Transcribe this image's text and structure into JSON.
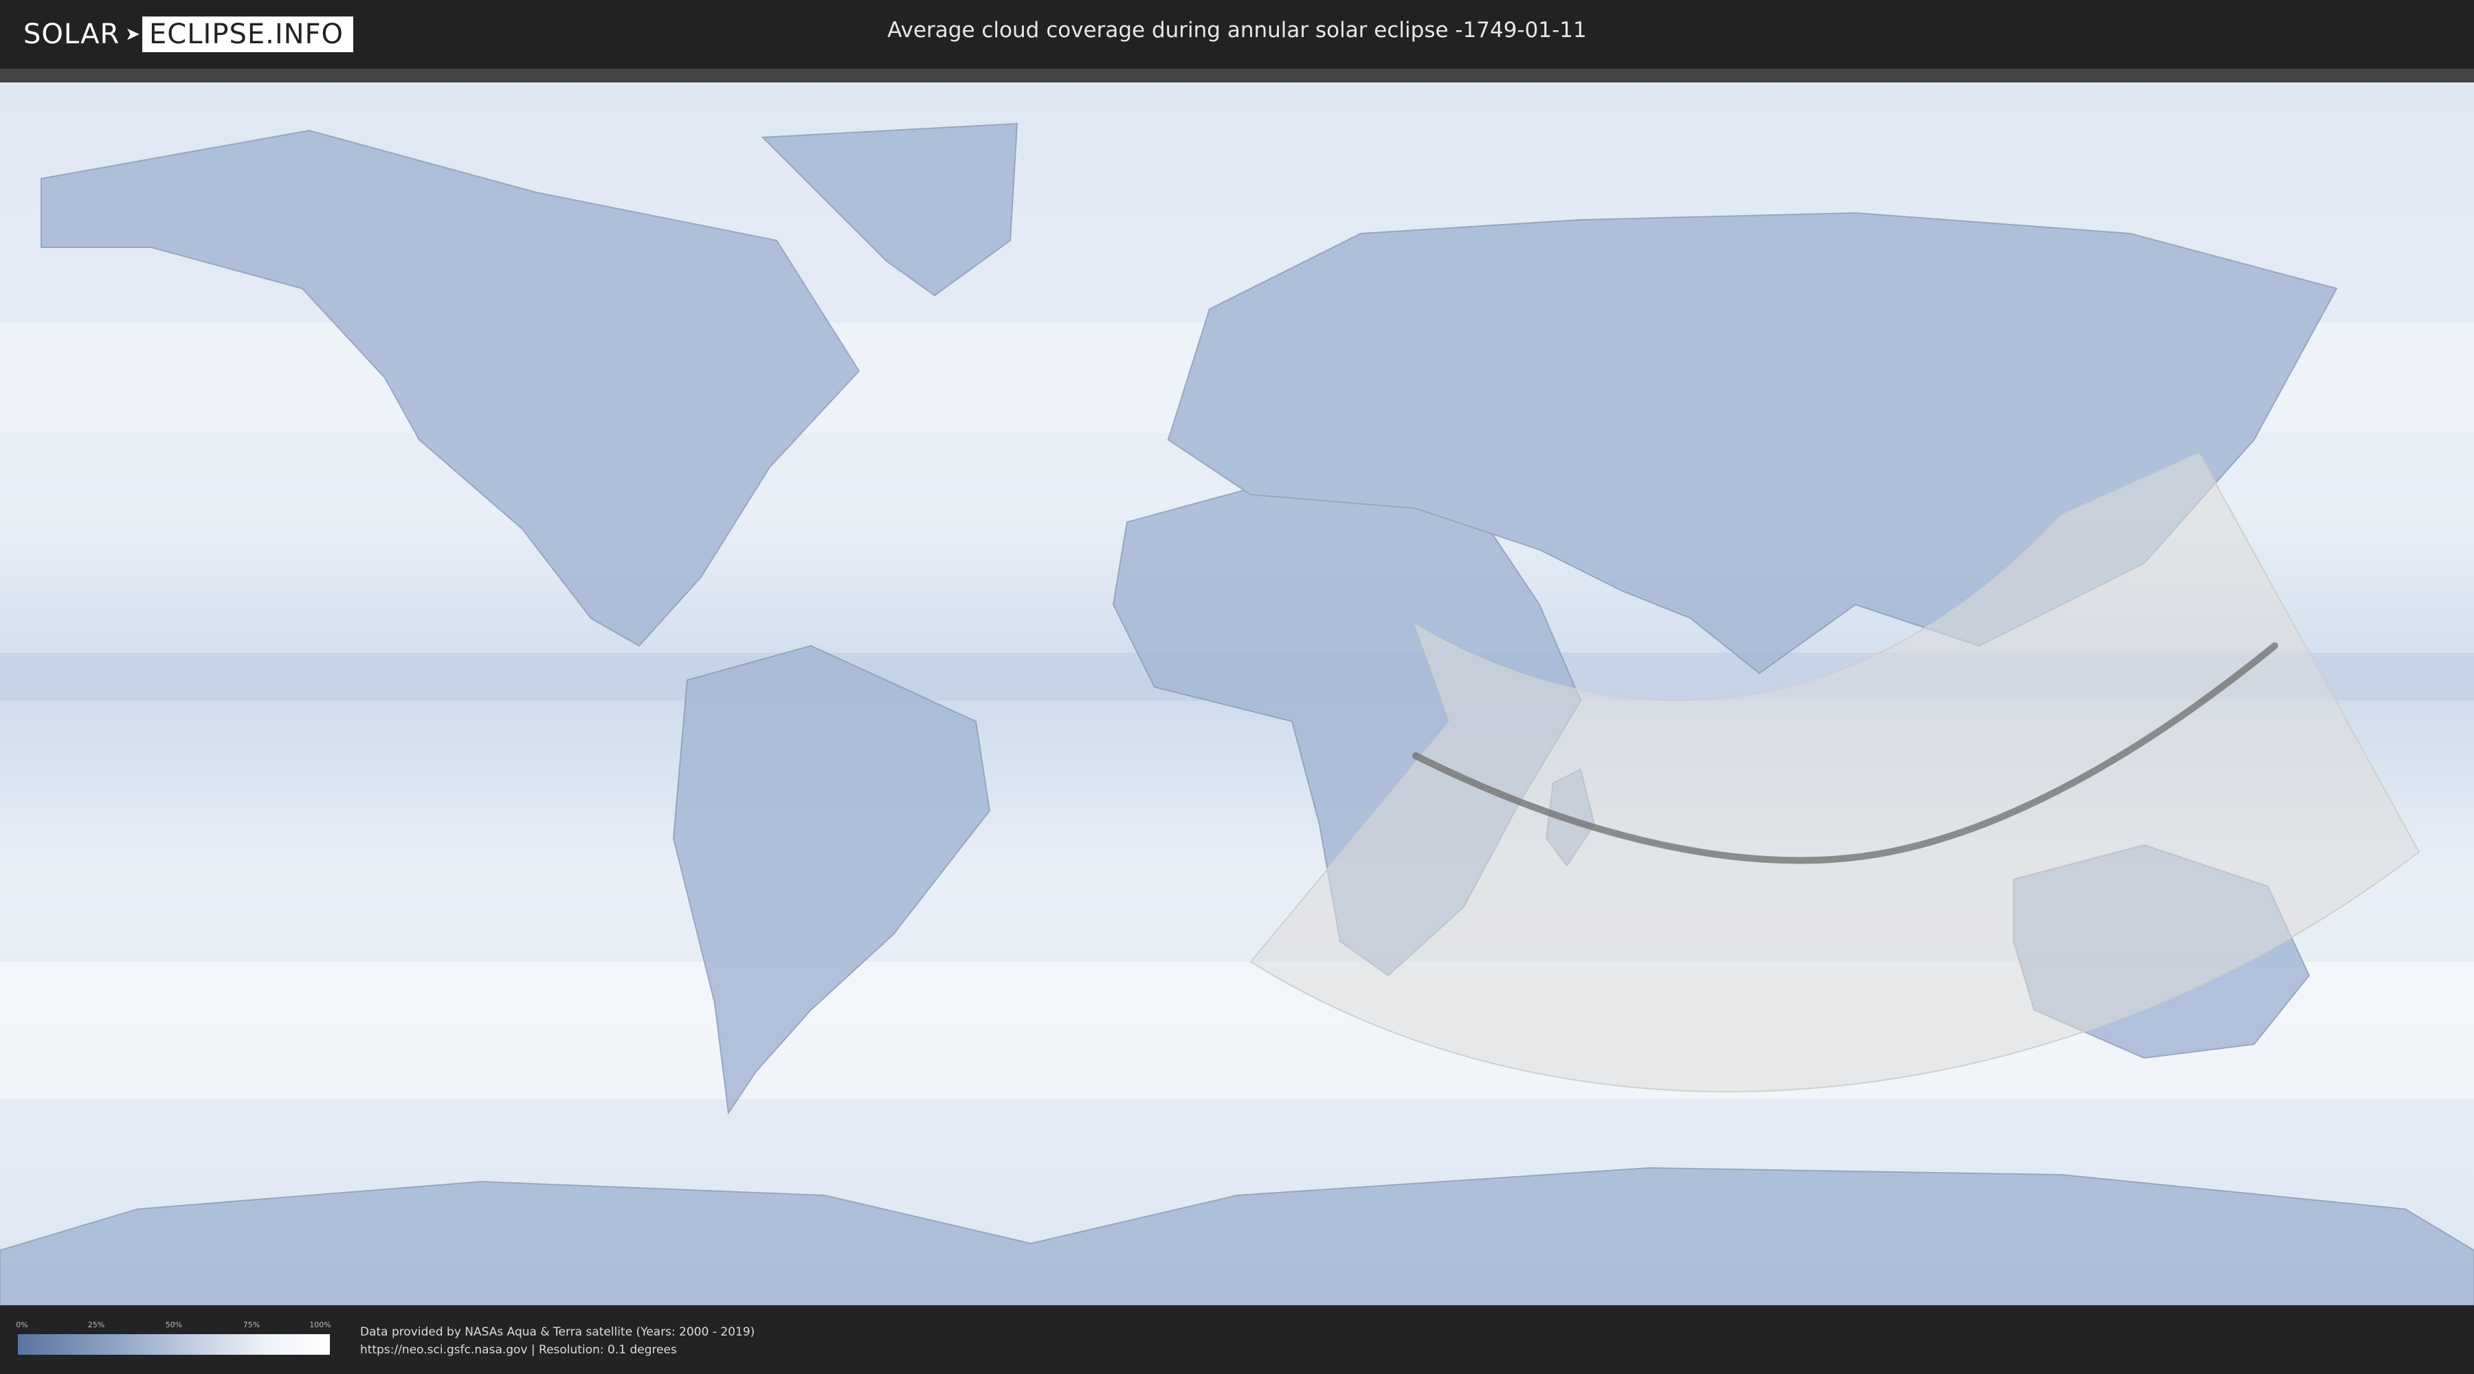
{
  "header": {
    "logo_left": "SOLAR",
    "logo_right": "ECLIPSE.INFO",
    "title": "Average cloud coverage during annular solar eclipse -1749-01-11"
  },
  "legend": {
    "ticks": [
      "0%",
      "25%",
      "50%",
      "75%",
      "100%"
    ],
    "colors": {
      "low": "#5b73a0",
      "high": "#ffffff"
    }
  },
  "credits": {
    "line1": "Data provided by NASAs Aqua & Terra satellite (Years: 2000 - 2019)",
    "line2": "https://neo.sci.gsfc.nasa.gov | Resolution: 0.1 degrees"
  },
  "map": {
    "projection": "equirectangular",
    "ocean_color": "#e7edf6",
    "land_color": "#9fb2d3",
    "overlay_color": "#dcdcdc",
    "path_color": "#6e6e6e"
  }
}
